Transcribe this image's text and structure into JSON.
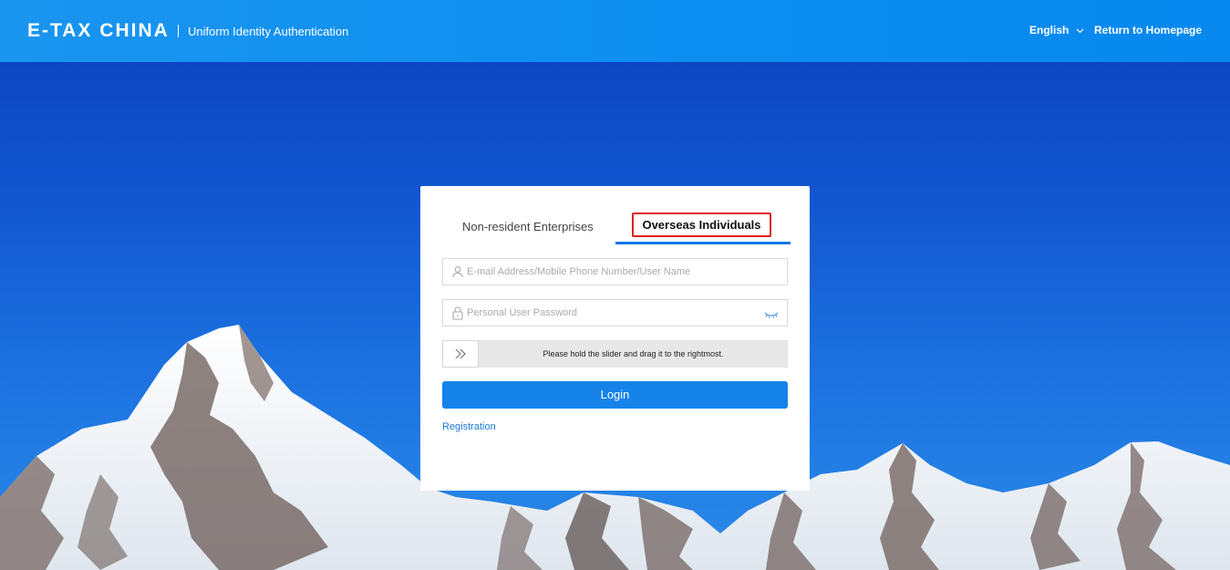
{
  "header": {
    "logo": "E-TAX CHINA",
    "subtitle": "Uniform Identity Authentication",
    "language": "English",
    "language_icon": "chevron-down-icon",
    "home_link": "Return to Homepage"
  },
  "login": {
    "tabs": [
      {
        "label": "Non-resident Enterprises",
        "active": false
      },
      {
        "label": "Overseas Individuals",
        "active": true
      }
    ],
    "username": {
      "placeholder": "E-mail Address/Mobile Phone Number/User Name",
      "value": "",
      "icon": "user-icon"
    },
    "password": {
      "placeholder": "Personal User Password",
      "value": "",
      "icon": "lock-icon",
      "toggle_icon": "eye-closed-icon"
    },
    "slider": {
      "text": "Please hold the slider and drag it to the rightmost.",
      "icon": "double-chevron-right-icon"
    },
    "login_button": "Login",
    "registration_link": "Registration"
  },
  "colors": {
    "header_bg": "#0b8ef0",
    "accent": "#1583ea",
    "active_tab_underline": "#1277e8",
    "highlight_box": "#e02020",
    "link": "#1a78d6"
  }
}
